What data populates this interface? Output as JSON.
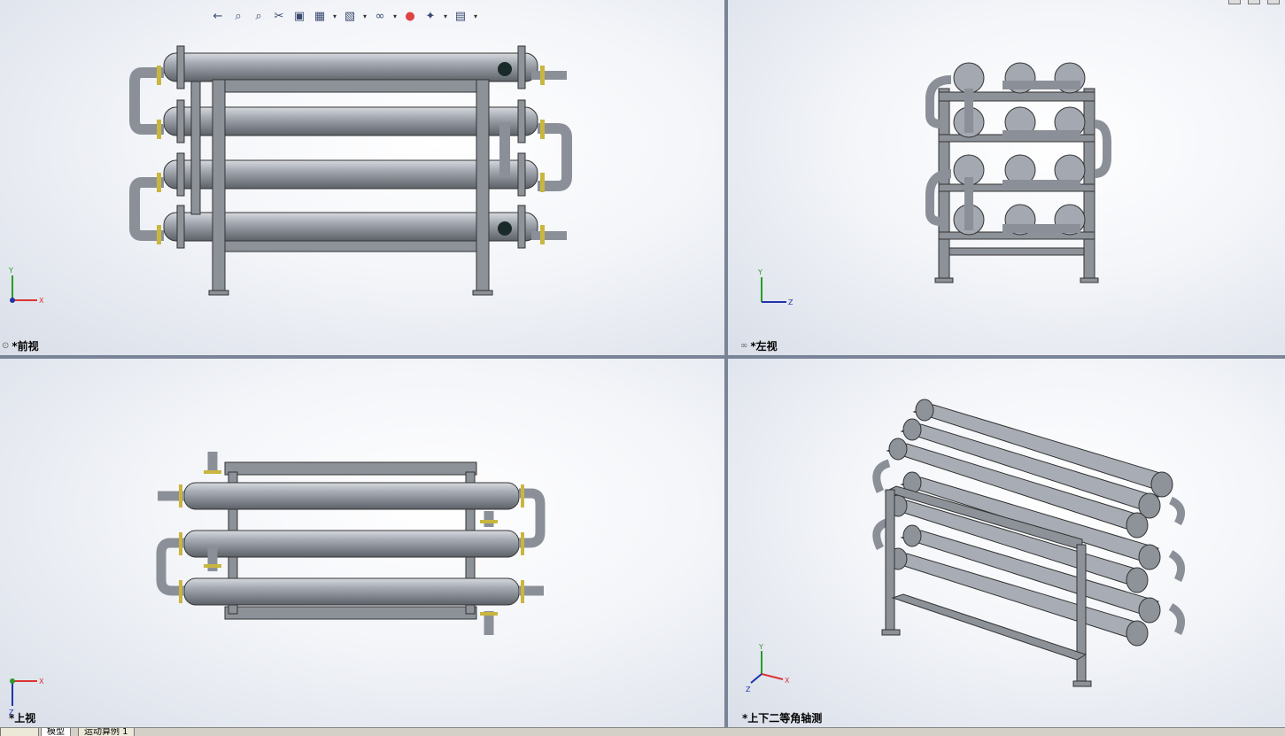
{
  "viewports": {
    "front": {
      "label": "*前视"
    },
    "left": {
      "label": "*左视"
    },
    "top": {
      "label": "*上视"
    },
    "iso": {
      "label": "*上下二等角轴测"
    }
  },
  "toolbar": {
    "icons": [
      "previous-view-icon",
      "zoom-to-fit-icon",
      "zoom-to-area-icon",
      "section-view-icon",
      "view-orientation-icon",
      "display-style-icon",
      "hide-show-items-icon",
      "edit-appearance-icon",
      "apply-scene-icon",
      "view-settings-icon"
    ]
  },
  "axes": {
    "x": "X",
    "y": "Y",
    "z": "Z"
  },
  "tabs": [
    {
      "label": "模型"
    },
    {
      "label": "运动算例 1"
    }
  ],
  "colors": {
    "steel": "#9ea3ab",
    "frame": "#8d9299",
    "flange_accent": "#c9b640",
    "bg": "#7a8497"
  }
}
